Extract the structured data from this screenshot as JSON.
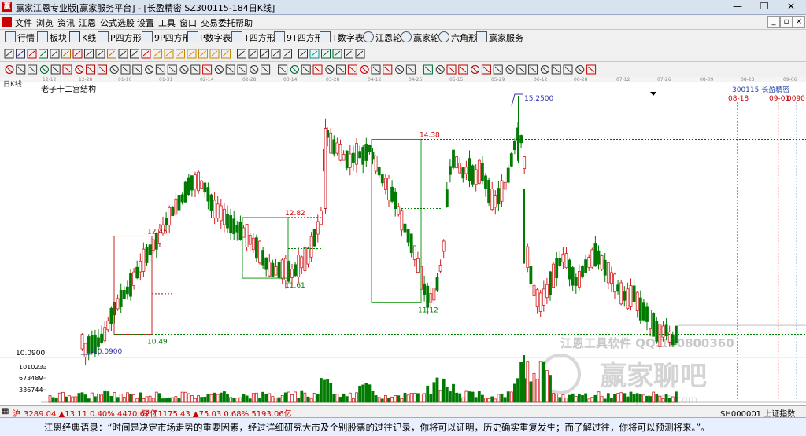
{
  "window": {
    "title": "赢家江恩专业版[赢家服务平台] - [长盈精密  SZ300115-184日K线]"
  },
  "menu": [
    "文件",
    "浏览",
    "资讯",
    "江恩",
    "公式选股",
    "设置",
    "工具",
    "窗口",
    "交易委托",
    "帮助"
  ],
  "toolbar": {
    "items": [
      {
        "label": "行情",
        "icon": "quote-icon"
      },
      {
        "label": "板块",
        "icon": "sector-icon"
      },
      {
        "label": "K线",
        "icon": "kline-icon"
      },
      {
        "label": "P四方形",
        "icon": "square-icon"
      },
      {
        "label": "9P四方形",
        "icon": "square9-icon"
      },
      {
        "label": "P数字表",
        "icon": "table-icon"
      },
      {
        "label": "T四方形",
        "icon": "tsquare-icon"
      },
      {
        "label": "9T四方形",
        "icon": "tsquare9-icon"
      },
      {
        "label": "T数字表",
        "icon": "ttable-icon"
      },
      {
        "label": "江恩轮",
        "icon": "gann-wheel-icon"
      },
      {
        "label": "赢家轮",
        "icon": "winner-wheel-icon"
      },
      {
        "label": "六角形",
        "icon": "hexagon-icon"
      },
      {
        "label": "赢家服务",
        "icon": "service-icon"
      }
    ]
  },
  "chart": {
    "period_label": "日K线",
    "indicator_label": "老子十二宫结构",
    "stock_label": "300115 长盈精密",
    "date_markers": [
      "08-18",
      "09-01",
      "0090"
    ],
    "time_axis": [
      "12-12",
      "12-28",
      "01-10",
      "01-31",
      "02-14",
      "02-28",
      "03-14",
      "03-28",
      "04-12",
      "04-26",
      "05-15",
      "05-29",
      "06-12",
      "06-28",
      "07-12",
      "07-26",
      "08-09",
      "08-23",
      "09-06"
    ],
    "price_labels": {
      "high": "15.2500",
      "p1438": "14.38",
      "p1282": "12.82",
      "p1245": "12.45",
      "p1161": "11.61",
      "p1112": "11.12",
      "p1049": "10.49",
      "low": "10.0900",
      "axis_low": "10.0900"
    },
    "volume_labels": [
      "1010233",
      "673489",
      "336744"
    ],
    "watermark1": "江恩工具软件  QQ:100800360",
    "watermark2": "赢家聊吧",
    "watermark3": "liaoba.yu1360.com",
    "colors": {
      "up": "#d22020",
      "down": "#007a00",
      "box_green": "#1a9a1a",
      "box_red": "#d22020",
      "dash_red": "#cc0000",
      "dash_green": "#008000"
    }
  },
  "status": {
    "sh": "3289.04 ▲13.11 0.40% 4470.62亿",
    "sz": "11175.43 ▲75.03 0.68% 5193.06亿",
    "index": "SH000001 上证指数"
  },
  "quote": "江恩经典语录：“时间是决定市场走势的重要因素，经过详细研究大市及个别股票的过往记录，你将可以证明，历史确实重复发生；而了解过往，你将可以预测将来。”。"
}
